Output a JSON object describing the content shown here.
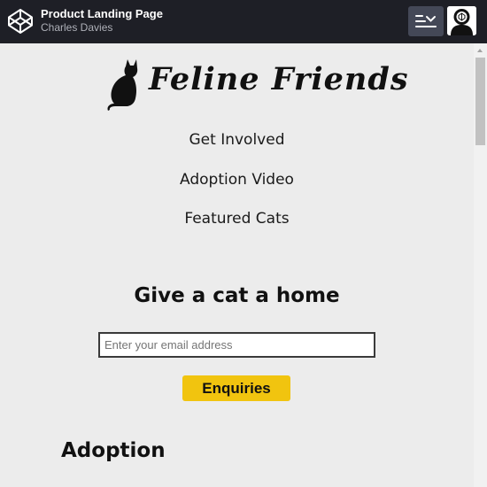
{
  "header": {
    "pen_title": "Product Landing Page",
    "author": "Charles Davies",
    "view_icon": "layout-toggle-icon",
    "avatar_icon": "user-avatar-icon"
  },
  "page": {
    "brand_name": "Feline Friends",
    "brand_icon": "cat-silhouette-icon",
    "nav": [
      "Get Involved",
      "Adoption Video",
      "Featured Cats"
    ],
    "hero_title": "Give a cat a home",
    "email_placeholder": "Enter your email address",
    "email_value": "",
    "submit_label": "Enquiries",
    "section_title": "Adoption"
  },
  "colors": {
    "topbar": "#1e1f26",
    "page_bg": "#ececec",
    "accent": "#f1c40f"
  }
}
